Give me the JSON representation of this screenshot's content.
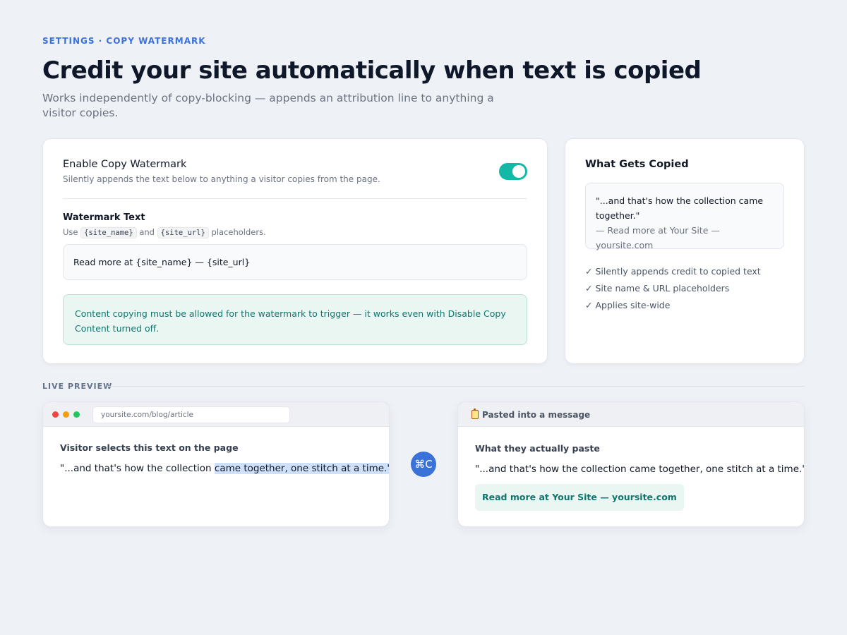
{
  "header": {
    "eyebrow": "SETTINGS · COPY WATERMARK",
    "title": "Credit your site automatically when text is copied",
    "subtitle": "Works independently of copy-blocking — appends an attribution line to anything a visitor copies."
  },
  "settings": {
    "enable_title": "Enable Copy Watermark",
    "enable_desc": "Silently appends the text below to anything a visitor copies from the page.",
    "toggle_on": true,
    "watermark_label": "Watermark Text",
    "help_prefix": "Use",
    "help_code_1": "{site_name}",
    "help_and": "and",
    "help_code_2": "{site_url}",
    "help_suffix": "placeholders.",
    "watermark_value": "Read more at {site_name} — {site_url}",
    "notice": "Content copying must be allowed for the watermark to trigger — it works even with Disable Copy Content turned off."
  },
  "copied": {
    "title": "What Gets Copied",
    "quote": "\"...and that's how the collection came together.\"",
    "attribution": "— Read more at Your Site — yoursite.com",
    "checklist": [
      "Silently appends credit to copied text",
      "Site name & URL placeholders",
      "Applies site-wide"
    ],
    "check_glyph": "✓"
  },
  "live_preview": {
    "label": "LIVE PREVIEW",
    "browser": {
      "url": "yoursite.com/blog/article",
      "heading": "Visitor selects this text on the page",
      "quote_plain": "\"...and that's how the collection ",
      "quote_selected": "came together, one stitch at a time.\""
    },
    "shortcut": "⌘C",
    "paste": {
      "title": "Pasted into a message",
      "heading": "What they actually paste",
      "quote": "\"...and that's how the collection came together, one stitch at a time.\"",
      "attribution": "Read more at Your Site — yoursite.com"
    }
  },
  "colors": {
    "accent": "#3b72d9",
    "toggle": "#14b8a6",
    "success_bg": "#e9f6f1",
    "success_text": "#0f766e",
    "selection": "#cfe0fb"
  }
}
